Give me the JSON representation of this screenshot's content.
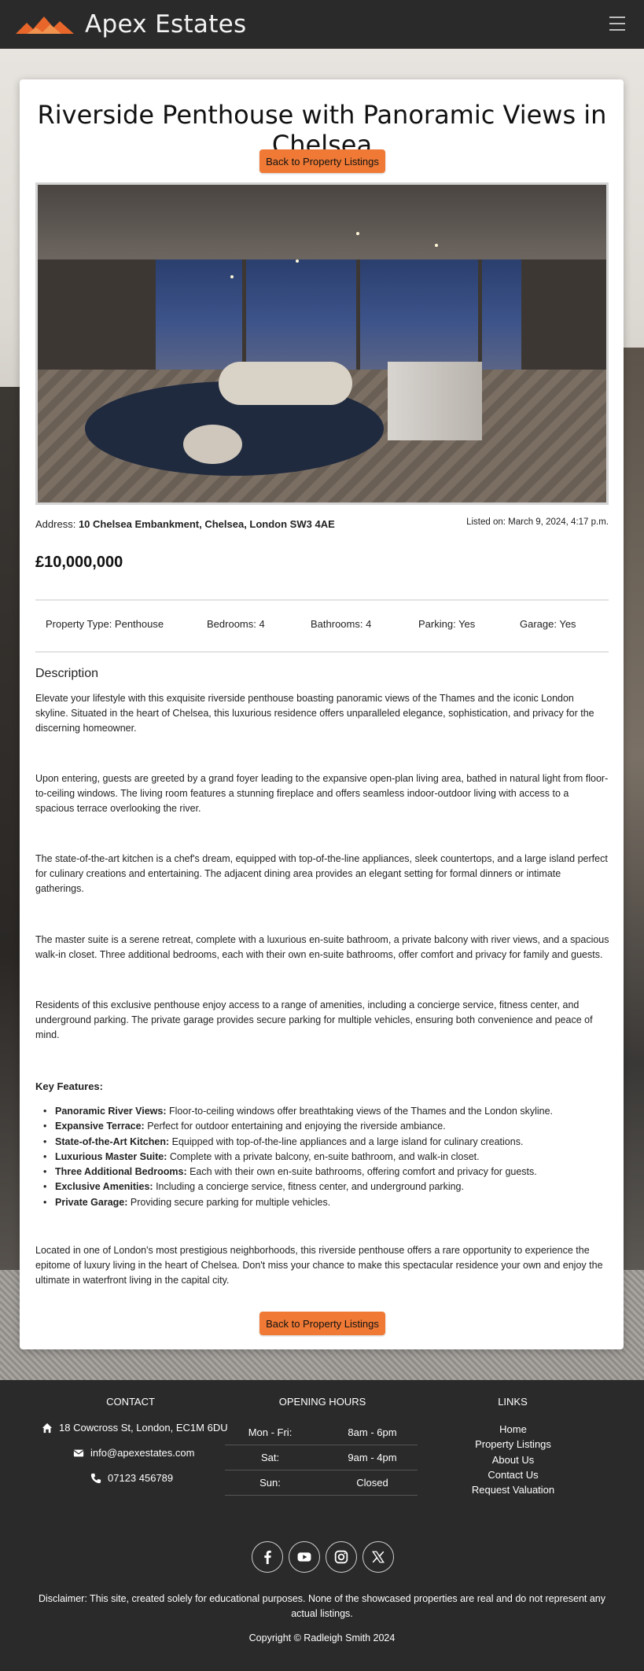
{
  "header": {
    "brand": "Apex Estates",
    "logo_icon": "mountain-logo-icon",
    "menu_icon": "hamburger-menu-icon"
  },
  "property": {
    "title": "Riverside Penthouse with Panoramic Views in Chelsea",
    "back_label": "Back to Property Listings",
    "address_label": "Address:",
    "address": "10 Chelsea Embankment, Chelsea, London SW3 4AE",
    "listed": "Listed on: March 9, 2024, 4:17 p.m.",
    "price": "£10,000,000",
    "features": {
      "type": "Property Type: Penthouse",
      "bedrooms": "Bedrooms: 4",
      "bathrooms": "Bathrooms: 4",
      "parking": "Parking: Yes",
      "garage": "Garage: Yes"
    },
    "description_heading": "Description",
    "paragraphs": [
      "Elevate your lifestyle with this exquisite riverside penthouse boasting panoramic views of the Thames and the iconic London skyline. Situated in the heart of Chelsea, this luxurious residence offers unparalleled elegance, sophistication, and privacy for the discerning homeowner.",
      "Upon entering, guests are greeted by a grand foyer leading to the expansive open-plan living area, bathed in natural light from floor-to-ceiling windows. The living room features a stunning fireplace and offers seamless indoor-outdoor living with access to a spacious terrace overlooking the river.",
      "The state-of-the-art kitchen is a chef's dream, equipped with top-of-the-line appliances, sleek countertops, and a large island perfect for culinary creations and entertaining. The adjacent dining area provides an elegant setting for formal dinners or intimate gatherings.",
      "The master suite is a serene retreat, complete with a luxurious en-suite bathroom, a private balcony with river views, and a spacious walk-in closet. Three additional bedrooms, each with their own en-suite bathrooms, offer comfort and privacy for family and guests.",
      "Residents of this exclusive penthouse enjoy access to a range of amenities, including a concierge service, fitness center, and underground parking. The private garage provides secure parking for multiple vehicles, ensuring both convenience and peace of mind.",
      "Located in one of London's most prestigious neighborhoods, this riverside penthouse offers a rare opportunity to experience the epitome of luxury living in the heart of Chelsea. Don't miss your chance to make this spectacular residence your own and enjoy the ultimate in waterfront living in the capital city."
    ],
    "key_heading": "Key Features:",
    "key_features": [
      {
        "name": "Panoramic River Views:",
        "text": "Floor-to-ceiling windows offer breathtaking views of the Thames and the London skyline."
      },
      {
        "name": "Expansive Terrace:",
        "text": "Perfect for outdoor entertaining and enjoying the riverside ambiance."
      },
      {
        "name": "State-of-the-Art Kitchen:",
        "text": "Equipped with top-of-the-line appliances and a large island for culinary creations."
      },
      {
        "name": "Luxurious Master Suite:",
        "text": "Complete with a private balcony, en-suite bathroom, and walk-in closet."
      },
      {
        "name": "Three Additional Bedrooms:",
        "text": "Each with their own en-suite bathrooms, offering comfort and privacy for guests."
      },
      {
        "name": "Exclusive Amenities:",
        "text": "Including a concierge service, fitness center, and underground parking."
      },
      {
        "name": "Private Garage:",
        "text": "Providing secure parking for multiple vehicles."
      }
    ]
  },
  "footer": {
    "contact_heading": "CONTACT",
    "address": "18 Cowcross St, London, EC1M 6DU",
    "email": "info@apexestates.com",
    "phone": "07123 456789",
    "hours_heading": "OPENING HOURS",
    "hours": [
      {
        "day": "Mon - Fri:",
        "time": "8am - 6pm"
      },
      {
        "day": "Sat:",
        "time": "9am - 4pm"
      },
      {
        "day": "Sun:",
        "time": "Closed"
      }
    ],
    "links_heading": "LINKS",
    "links": [
      "Home",
      "Property Listings",
      "About Us",
      "Contact Us",
      "Request Valuation"
    ],
    "social_icons": [
      "facebook-icon",
      "youtube-icon",
      "instagram-icon",
      "x-icon"
    ],
    "disclaimer": "Disclaimer: This site, created solely for educational purposes. None of the showcased properties are real and do not represent any actual listings.",
    "copyright": "Copyright © Radleigh Smith 2024"
  },
  "colors": {
    "accent": "#f07a35",
    "dark": "#2a2a2b",
    "card": "#ffffff"
  }
}
